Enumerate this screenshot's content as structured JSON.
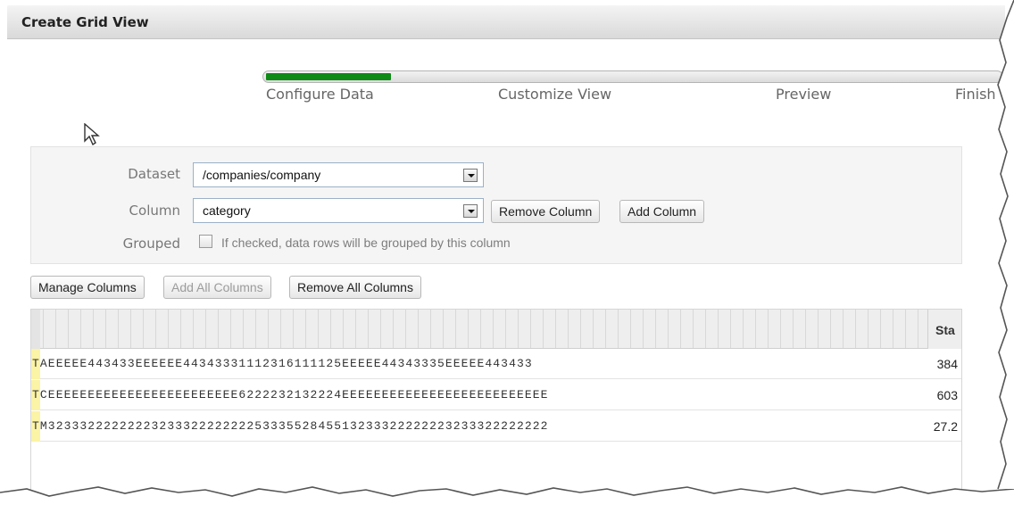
{
  "header": {
    "title": "Create Grid View"
  },
  "wizard": {
    "progress_percent": 17,
    "steps": [
      "Configure Data",
      "Customize View",
      "Preview",
      "Finish"
    ]
  },
  "form": {
    "dataset_label": "Dataset",
    "dataset_value": "/companies/company",
    "column_label": "Column",
    "column_value": "category",
    "remove_column_label": "Remove Column",
    "add_column_label": "Add Column",
    "grouped_label": "Grouped",
    "grouped_hint": "If checked, data rows will be grouped by this column"
  },
  "toolbar": {
    "manage_columns_label": "Manage Columns",
    "add_all_columns_label": "Add All Columns",
    "remove_all_columns_label": "Remove All Columns"
  },
  "grid": {
    "last_column_header": "Sta",
    "rows": [
      {
        "cells": "TAEEEEE443433EEEEEE44343331112316111125EEEEE44343335EEEEE443433",
        "value": "384"
      },
      {
        "cells": "TCEEEEEEEEEEEEEEEEEEEEEEEE6222232132224EEEEEEEEEEEEEEEEEEEEEEEEEE",
        "value": "603"
      },
      {
        "cells": "TM323332222222232333222222225333552845513233322222223233322222222",
        "value": "27.2"
      }
    ]
  },
  "colors": {
    "progress": "#0f8a16",
    "row_marker": "#fbf3a6"
  }
}
